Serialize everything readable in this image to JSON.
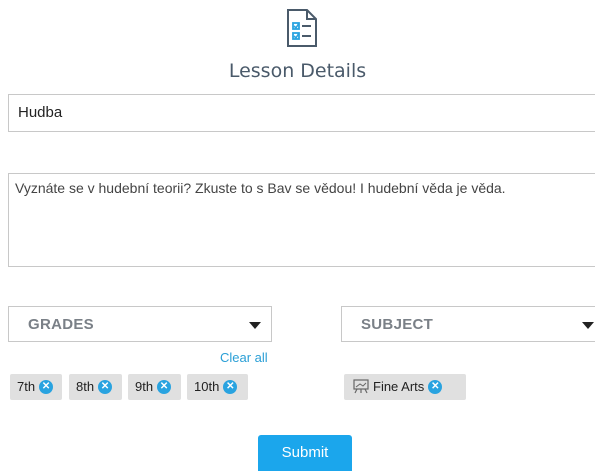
{
  "header": {
    "title": "Lesson Details",
    "icon": "checklist-document-icon"
  },
  "form": {
    "name_value": "Hudba",
    "description_value": "Vyznáte se v hudební teorii? Zkuste to s Bav se vědou! I hudební věda je věda."
  },
  "grades": {
    "label": "GRADES",
    "clear_all": "Clear all",
    "chips": [
      "7th",
      "8th",
      "9th",
      "10th"
    ]
  },
  "subject": {
    "label": "SUBJECT",
    "chips": [
      {
        "label": "Fine Arts",
        "icon": "easel-icon"
      }
    ]
  },
  "submit_label": "Submit",
  "colors": {
    "accent": "#1ba6ec",
    "chip_bg": "#e0e0e0",
    "link": "#2a9fd6"
  }
}
